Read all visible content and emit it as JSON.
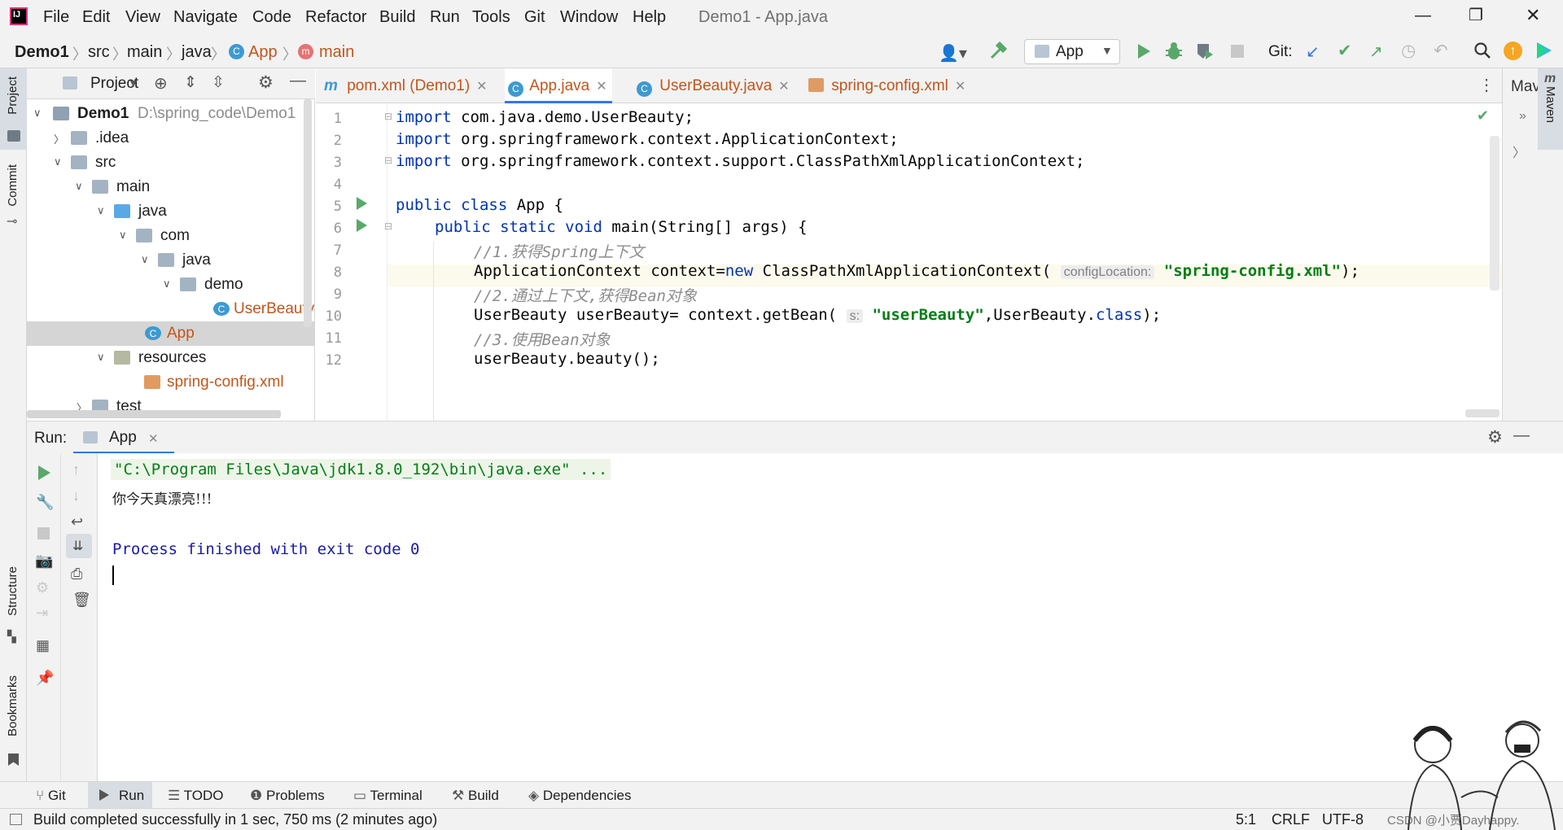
{
  "window_title": "Demo1 - App.java",
  "menu": [
    "File",
    "Edit",
    "View",
    "Navigate",
    "Code",
    "Refactor",
    "Build",
    "Run",
    "Tools",
    "Git",
    "Window",
    "Help"
  ],
  "breadcrumb": [
    "Demo1",
    "src",
    "main",
    "java",
    "App",
    "main"
  ],
  "run_config": "App",
  "git_label": "Git:",
  "left_stripe": {
    "project": "Project",
    "commit": "Commit",
    "structure": "Structure",
    "bookmarks": "Bookmarks"
  },
  "project_panel": {
    "title": "Project",
    "tree": [
      {
        "label": "Demo1",
        "path": "D:\\spring_code\\Demo1"
      },
      {
        "label": ".idea"
      },
      {
        "label": "src"
      },
      {
        "label": "main"
      },
      {
        "label": "java"
      },
      {
        "label": "com"
      },
      {
        "label": "java"
      },
      {
        "label": "demo"
      },
      {
        "label": "UserBeauty"
      },
      {
        "label": "App"
      },
      {
        "label": "resources"
      },
      {
        "label": "spring-config.xml"
      },
      {
        "label": "test"
      }
    ]
  },
  "tabs": [
    "pom.xml (Demo1)",
    "App.java",
    "UserBeauty.java",
    "spring-config.xml"
  ],
  "code": {
    "line_numbers": [
      "1",
      "2",
      "3",
      "4",
      "5",
      "6",
      "7",
      "8",
      "9",
      "10",
      "11",
      "12"
    ],
    "l1_kw": "import",
    "l1_rest": " com.java.demo.UserBeauty;",
    "l2_kw": "import",
    "l2_rest": " org.springframework.context.ApplicationContext;",
    "l3_kw": "import",
    "l3_rest": " org.springframework.context.support.ClassPathXmlApplicationContext;",
    "l5_kw": "public class",
    "l5_rest": " App {",
    "l6_kw": "public static void",
    "l6_rest": " main(String[] args) {",
    "l7_comment": "//1.获得Spring上下文",
    "l8_a": "ApplicationContext context=",
    "l8_kw": "new",
    "l8_b": " ClassPathXmlApplicationContext(",
    "l8_hint": "configLocation:",
    "l8_str": "\"spring-config.xml\"",
    "l8_end": ");",
    "l9_comment": "//2.通过上下文,获得Bean对象",
    "l10_a": "UserBeauty userBeauty= context.getBean(",
    "l10_hint": "s:",
    "l10_str": "\"userBeauty\"",
    "l10_b": ",UserBeauty.",
    "l10_kw": "class",
    "l10_end": ");",
    "l11_comment": "//3.使用Bean对象",
    "l12": "userBeauty.beauty();"
  },
  "right_stripe": {
    "maven_short": "Mav",
    "maven": "Maven"
  },
  "run_panel": {
    "label": "Run:",
    "tab": "App",
    "console": [
      "\"C:\\Program Files\\Java\\jdk1.8.0_192\\bin\\java.exe\" ...",
      "你今天真漂亮!!!",
      "Process finished with exit code 0"
    ]
  },
  "tool_windows": [
    "Git",
    "Run",
    "TODO",
    "Problems",
    "Terminal",
    "Build",
    "Dependencies"
  ],
  "status": {
    "message": "Build completed successfully in 1 sec, 750 ms (2 minutes ago)",
    "position": "5:1",
    "line_sep": "CRLF",
    "encoding": "UTF-8",
    "watermark": "CSDN @小贾Dayhappy."
  },
  "colors": {
    "accent": "#3574f0",
    "run_green": "#59a869",
    "keyword": "#0033b3",
    "string": "#067d17",
    "comment": "#8c8c8c",
    "console_blue": "#1a1aa6"
  }
}
